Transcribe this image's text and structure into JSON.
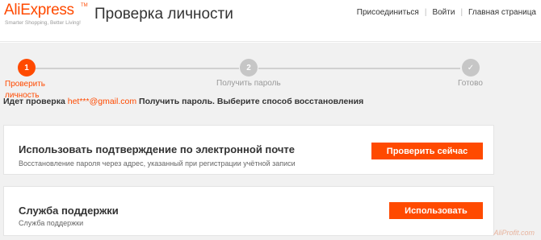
{
  "header": {
    "logo_text": "AliExpress",
    "logo_tm": "TM",
    "logo_tagline": "Smarter Shopping, Better Living!",
    "title": "Проверка личности",
    "nav": {
      "join": "Присоединиться",
      "sep": "|",
      "login": "Войти",
      "home": "Главная страница"
    }
  },
  "progress": {
    "steps": [
      {
        "num": "1",
        "label": "Проверить\nличность",
        "state": "active"
      },
      {
        "num": "2",
        "label": "Получить пароль",
        "state": "inactive"
      },
      {
        "num": "✓",
        "label": "Готово",
        "state": "inactive"
      }
    ]
  },
  "info": {
    "prefix": "Идет проверка",
    "email": "het***@gmail.com",
    "suffix": "Получить пароль. Выберите способ восстановления"
  },
  "options": [
    {
      "title": "Использовать подтверждение по электронной почте",
      "subtitle": "Восстановление пароля через адрес, указанный при регистрации учётной записи",
      "button": "Проверить сейчас"
    },
    {
      "title": "Служба поддержки",
      "subtitle": "Служба поддержки",
      "button": "Использовать"
    }
  ],
  "watermark": "AliProfit.com",
  "colors": {
    "accent": "#ff4a00",
    "inactive": "#c6c6c6",
    "background": "#f1f1f1"
  }
}
